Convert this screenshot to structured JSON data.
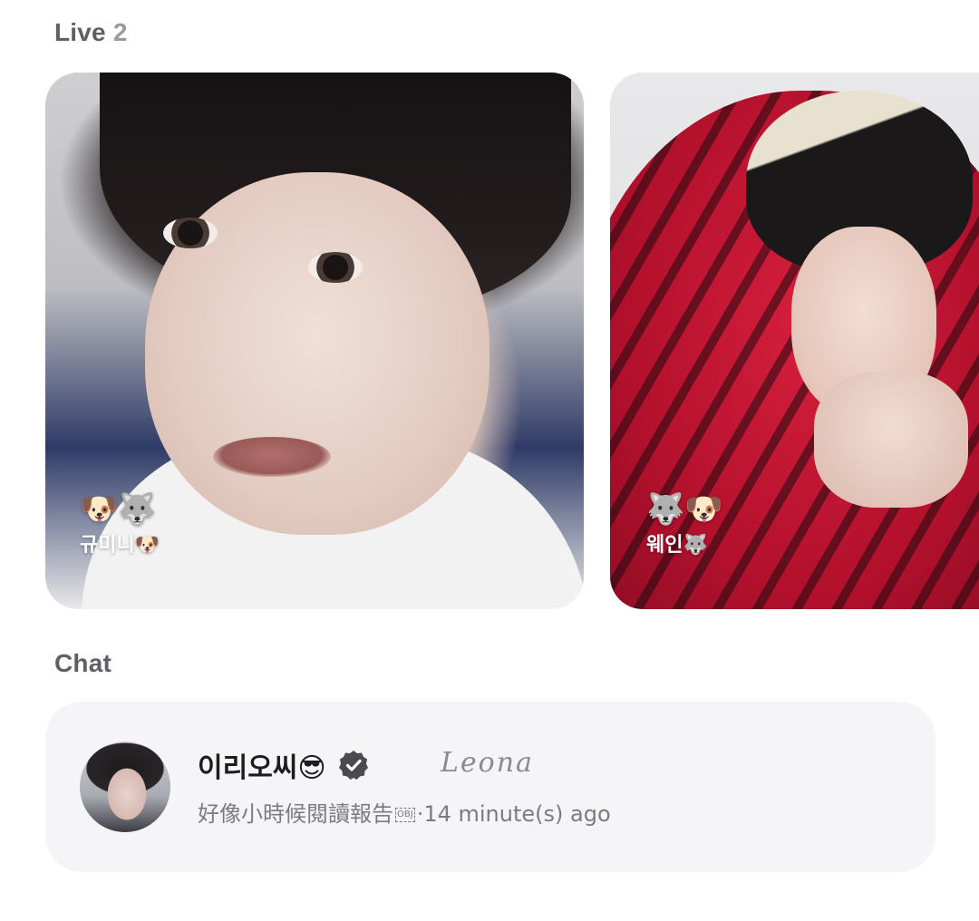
{
  "live": {
    "title": "Live",
    "count": "2",
    "cards": [
      {
        "emojis": "🐶🐺",
        "name": "규미니🐶"
      },
      {
        "emojis": "🐺🐶",
        "name": "웨인🐺"
      }
    ]
  },
  "chat": {
    "title": "Chat",
    "item": {
      "name": "이리오씨😎",
      "watermark": "Leona",
      "message": "好像小時候閱讀報告",
      "obj_marker": "OBJ",
      "separator": "·",
      "time": "14 minute(s) ago"
    }
  },
  "colors": {
    "header": "#5f5f66",
    "count": "#9a9aa0",
    "chat_bg": "#f5f5f7",
    "meta": "#7b7b82",
    "verified": "#4a4a50"
  },
  "icons": {
    "verified": "verified-badge-icon"
  }
}
